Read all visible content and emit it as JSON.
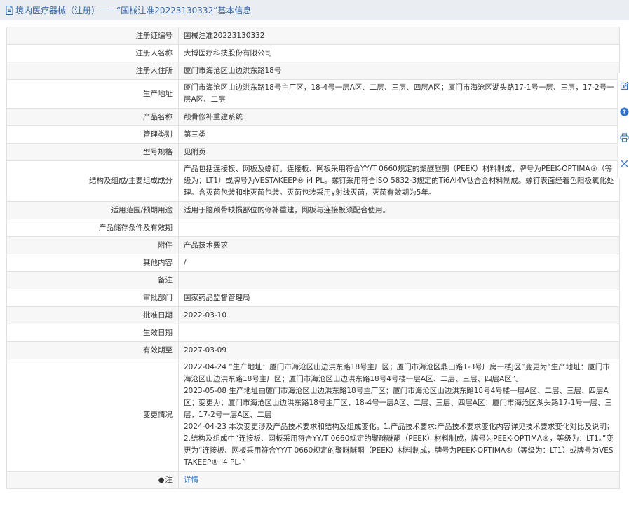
{
  "header": {
    "title": "境内医疗器械（注册）——“国械注准20223130332”基本信息"
  },
  "rows": [
    {
      "label": "注册证编号",
      "value": "国械注准20223130332"
    },
    {
      "label": "注册人名称",
      "value": "大博医疗科技股份有限公司"
    },
    {
      "label": "注册人住所",
      "value": "厦门市海沧区山边洪东路18号"
    },
    {
      "label": "生产地址",
      "value": "厦门市海沧区山边洪东路18号主厂区，18-4号一层A区、二层、三层、四层A区；厦门市海沧区湖头路17-1号一层、三层，17-2号一层A区、二层"
    },
    {
      "label": "产品名称",
      "value": "颅骨修补重建系统"
    },
    {
      "label": "管理类别",
      "value": "第三类"
    },
    {
      "label": "型号规格",
      "value": "见附页"
    },
    {
      "label": "结构及组成/主要组成成分",
      "value": "产品包括连接板、网板及螺钉。连接板、网板采用符合YY/T 0660规定的聚醚醚酮（PEEK）材料制成，牌号为PEEK-OPTIMA®（等级为：LT1）或牌号为VESTAKEEP® i4 PL。螺钉采用符合ISO 5832-3规定的Ti6Al4V钛合金材料制成。螺钉表面经着色阳极氧化处理。含灭菌包装和非灭菌包装。灭菌包装采用γ射线灭菌，灭菌有效期为5年。"
    },
    {
      "label": "适用范围/预期用途",
      "value": "适用于脑颅骨缺损部位的修补重建，网板与连接板须配合使用。"
    },
    {
      "label": "产品储存条件及有效期",
      "value": ""
    },
    {
      "label": "附件",
      "value": "产品技术要求"
    },
    {
      "label": "其他内容",
      "value": "/"
    },
    {
      "label": "备注",
      "value": ""
    },
    {
      "label": "审批部门",
      "value": "国家药品监督管理局"
    },
    {
      "label": "批准日期",
      "value": "2022-03-10"
    },
    {
      "label": "生效日期",
      "value": ""
    },
    {
      "label": "有效期至",
      "value": "2027-03-09"
    },
    {
      "label": "变更情况",
      "value": "2022-04-24 “生产地址：厦门市海沧区山边洪东路18号主厂区；厦门市海沧区鼎山路1-3号厂房一楼J区”变更为“生产地址：厦门市海沧区山边洪东路18号主厂区；厦门市海沧区山边洪东路18号4号楼一层A区、二层、三层、四层A区”。\n2023-05-08 生产地址由厦门市海沧区山边洪东路18号主厂区；厦门市海沧区山边洪东路18号4号楼一层A区、二层、三层、四层A区；变更为：厦门市海沧区山边洪东路18号主厂区，18-4号一层A区、二层、三层、四层A区；厦门市海沧区湖头路17-1号一层、三层，17-2号一层A区、二层\n2024-04-23 本次变更涉及产品技术要求和结构及组成变化。1.产品技术要求:产品技术要求变化内容详见技术要求变化对比及说明；2.结构及组成中“连接板、网板采用符合YY/T 0660规定的聚醚醚酮（PEEK）材料制成，牌号为PEEK-OPTIMA®，等级为：LT1。”变更为“连接板、网板采用符合YY/T 0660规定的聚醚醚酮（PEEK）材料制成，牌号为PEEK-OPTIMA®（等级为：LT1）或牌号为VESTAKEEP® i4 PL。”"
    }
  ],
  "note": {
    "pin_icon": "pin-icon",
    "label": "注",
    "link": "详情"
  },
  "side_tools": [
    "edit-icon",
    "help-icon",
    "print-icon",
    "close-icon"
  ],
  "colors": {
    "title": "#3466a6",
    "link": "#3a74c4",
    "tool": "#3a74c4"
  }
}
